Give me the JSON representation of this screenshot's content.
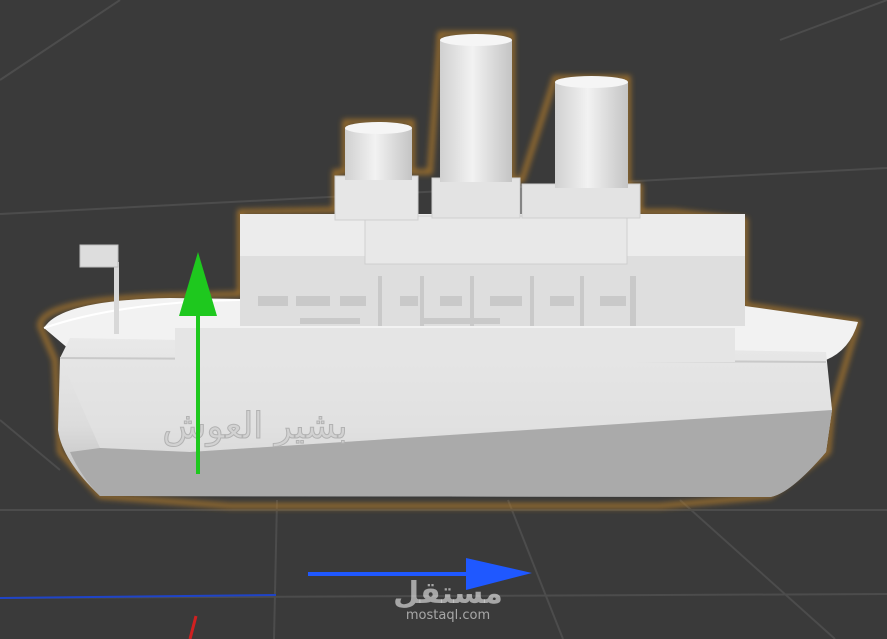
{
  "viewport": {
    "background_color": "#3a3a3a",
    "grid_color": "#4f4f4f",
    "model_color": "#e6e6e6",
    "selection_outline_color": "#b07a2a"
  },
  "ship": {
    "hull_text": "بشير العوش"
  },
  "gizmo": {
    "y_axis_color": "#1ec81e",
    "x_axis_color": "#1f58ff",
    "floor_axis_color": "#1f44c8",
    "red_axis_color": "#d02020"
  },
  "watermark": {
    "arabic": "مستقل",
    "latin": "mostaql.com"
  }
}
